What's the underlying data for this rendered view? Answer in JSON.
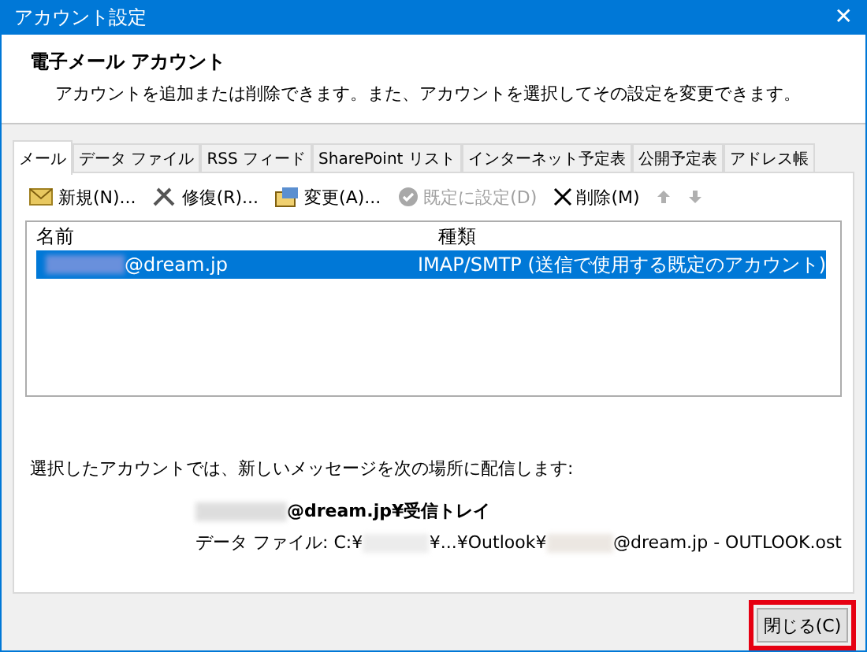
{
  "window": {
    "title": "アカウント設定",
    "close": "✕"
  },
  "header": {
    "title": "電子メール アカウント",
    "subtitle": "アカウントを追加または削除できます。また、アカウントを選択してその設定を変更できます。"
  },
  "tabs": [
    {
      "label": "メール",
      "selected": true
    },
    {
      "label": "データ ファイル",
      "selected": false
    },
    {
      "label": "RSS フィード",
      "selected": false
    },
    {
      "label": "SharePoint リスト",
      "selected": false
    },
    {
      "label": "インターネット予定表",
      "selected": false
    },
    {
      "label": "公開予定表",
      "selected": false
    },
    {
      "label": "アドレス帳",
      "selected": false
    }
  ],
  "toolbar": [
    {
      "kind": "new",
      "label": "新規(N)...",
      "disabled": false
    },
    {
      "kind": "repair",
      "label": "修復(R)...",
      "disabled": false
    },
    {
      "kind": "change",
      "label": "変更(A)...",
      "disabled": false
    },
    {
      "kind": "default",
      "label": "既定に設定(D)",
      "disabled": true
    },
    {
      "kind": "delete",
      "label": "削除(M)",
      "disabled": false
    },
    {
      "kind": "up",
      "disabled": true
    },
    {
      "kind": "down",
      "disabled": true
    }
  ],
  "table": {
    "columns": [
      "名前",
      "種類"
    ],
    "rows": [
      {
        "name": "@dream.jp",
        "type": "IMAP/SMTP (送信で使用する既定のアカウント)",
        "selected": true
      }
    ]
  },
  "delivery": {
    "intro": "選択したアカウントでは、新しいメッセージを次の場所に配信します:",
    "folder": "@dream.jp¥受信トレイ",
    "data_file_label": "データ ファイル: C:¥",
    "data_file_mid": "¥...¥Outlook¥",
    "data_file_end": "@dream.jp - OUTLOOK.ost"
  },
  "buttons": [
    {
      "label": "閉じる(C)",
      "highlighted": true
    }
  ]
}
